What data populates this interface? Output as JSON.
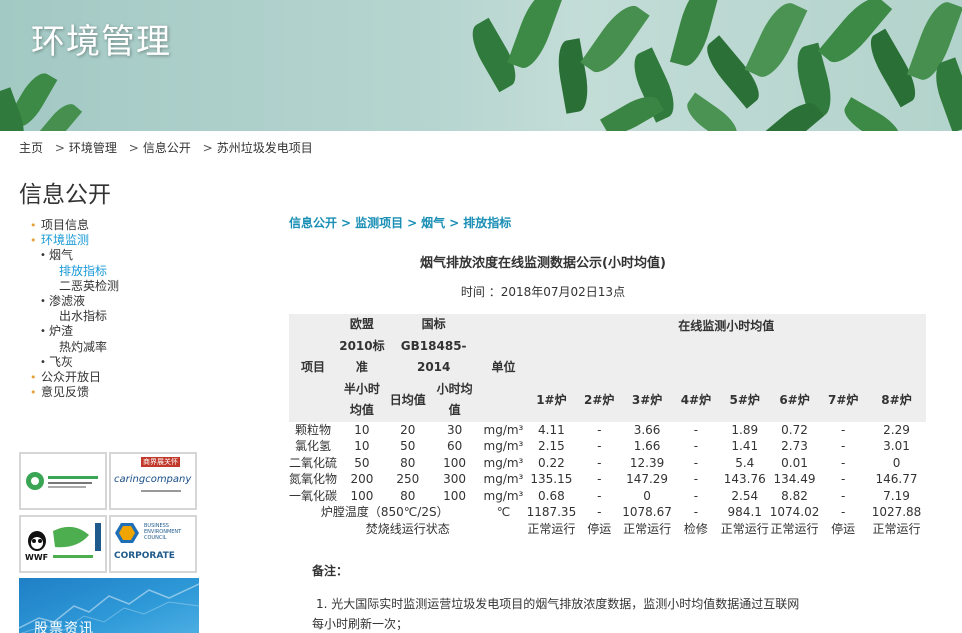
{
  "banner": {
    "title": "环境管理"
  },
  "breadcrumb": {
    "items": [
      "主页",
      "环境管理",
      "信息公开",
      "苏州垃圾发电项目"
    ],
    "separator": ">"
  },
  "sidebar": {
    "title": "信息公开",
    "nav": [
      {
        "label": "项目信息",
        "level": 1,
        "active": false
      },
      {
        "label": "环境监测",
        "level": 1,
        "active": true
      },
      {
        "label": "烟气",
        "level": 2,
        "active": false
      },
      {
        "label": "排放指标",
        "level": 3,
        "active": true
      },
      {
        "label": "二恶英检测",
        "level": 3,
        "active": false
      },
      {
        "label": "渗滤液",
        "level": 2,
        "active": false
      },
      {
        "label": "出水指标",
        "level": 3,
        "active": false
      },
      {
        "label": "炉渣",
        "level": 2,
        "active": false
      },
      {
        "label": "热灼减率",
        "level": 3,
        "active": false
      },
      {
        "label": "飞灰",
        "level": 2,
        "active": false
      },
      {
        "label": "公众开放日",
        "level": 1,
        "active": false
      },
      {
        "label": "意见反馈",
        "level": 1,
        "active": false
      }
    ],
    "logos": {
      "logo1_caption": "商界展关怀",
      "logo2_text": "caringcompany",
      "logo3_text": "WWF",
      "logo4_text": "CORPORATE",
      "logo4_sub": "BUSINESS ENVIRONMENT COUNCIL",
      "stock_label": "股票资讯"
    }
  },
  "content": {
    "crumb": [
      "信息公开",
      "监测项目",
      "烟气",
      "排放指标"
    ],
    "crumb_separator": ">",
    "title": "烟气排放浓度在线监测数据公示(小时均值)",
    "time": "时间 ：2018年07月02日13点",
    "table": {
      "h_item": "项目",
      "h_eu": "欧盟2010标准",
      "h_eu_sub": "半小时均值",
      "h_gb": "国标GB18485-2014",
      "h_gb_day": "日均值",
      "h_gb_hour": "小时均值",
      "h_unit": "单位",
      "h_online": "在线监测小时均值",
      "furnaces": [
        "1#炉",
        "2#炉",
        "3#炉",
        "4#炉",
        "5#炉",
        "6#炉",
        "7#炉",
        "8#炉"
      ],
      "rows": [
        {
          "item": "颗粒物",
          "eu": "10",
          "gb_day": "20",
          "gb_hour": "30",
          "unit": "mg/m³",
          "v": [
            "4.11",
            "-",
            "3.66",
            "-",
            "1.89",
            "0.72",
            "-",
            "2.29"
          ]
        },
        {
          "item": "氯化氢",
          "eu": "10",
          "gb_day": "50",
          "gb_hour": "60",
          "unit": "mg/m³",
          "v": [
            "2.15",
            "-",
            "1.66",
            "-",
            "1.41",
            "2.73",
            "-",
            "3.01"
          ]
        },
        {
          "item": "二氧化硫",
          "eu": "50",
          "gb_day": "80",
          "gb_hour": "100",
          "unit": "mg/m³",
          "v": [
            "0.22",
            "-",
            "12.39",
            "-",
            "5.4",
            "0.01",
            "-",
            "0"
          ]
        },
        {
          "item": "氮氧化物",
          "eu": "200",
          "gb_day": "250",
          "gb_hour": "300",
          "unit": "mg/m³",
          "v": [
            "135.15",
            "-",
            "147.29",
            "-",
            "143.76",
            "134.49",
            "-",
            "146.77"
          ]
        },
        {
          "item": "一氧化碳",
          "eu": "100",
          "gb_day": "80",
          "gb_hour": "100",
          "unit": "mg/m³",
          "v": [
            "0.68",
            "-",
            "0",
            "-",
            "2.54",
            "8.82",
            "-",
            "7.19"
          ]
        }
      ],
      "temp_row": {
        "label": "炉膛温度（850℃/2S）",
        "unit": "℃",
        "v": [
          "1187.35",
          "-",
          "1078.67",
          "-",
          "984.1",
          "1074.02",
          "-",
          "1027.88"
        ]
      },
      "status_row": {
        "label": "焚烧线运行状态",
        "v": [
          "正常运行",
          "停运",
          "正常运行",
          "检修",
          "正常运行",
          "正常运行",
          "停运",
          "正常运行"
        ]
      }
    },
    "notes": {
      "title": "备注：",
      "line1": "1. 光大国际实时监测运营垃圾发电项目的烟气排放浓度数据，监测小时均值数据通过互联网",
      "line2": "每小时刷新一次；"
    }
  }
}
